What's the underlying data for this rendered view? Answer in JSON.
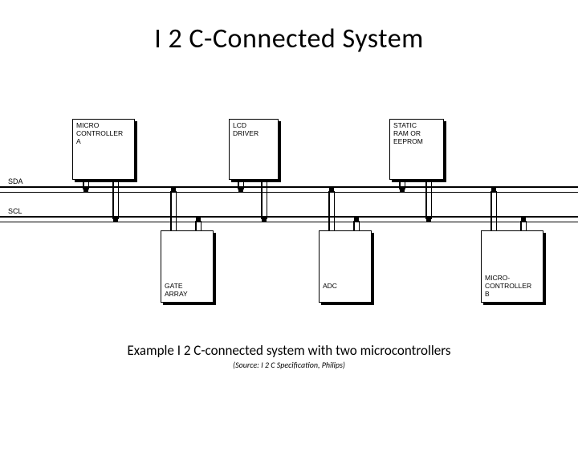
{
  "title": "I 2 C-Connected System",
  "caption": "Example I 2 C-connected system with two microcontrollers",
  "source": "(Source: I 2 C Specification, Philips)",
  "bus": {
    "sda": "SDA",
    "scl": "SCL"
  },
  "devices": {
    "top": [
      {
        "id": "microcontroller-a",
        "label": "MICRO\nCONTROLLER\nA"
      },
      {
        "id": "lcd-driver",
        "label": "LCD\nDRIVER"
      },
      {
        "id": "static-ram-eeprom",
        "label": "STATIC\nRAM OR\nEEPROM"
      }
    ],
    "bottom": [
      {
        "id": "gate-array",
        "label": "GATE\nARRAY"
      },
      {
        "id": "adc",
        "label": "ADC"
      },
      {
        "id": "microcontroller-b",
        "label": "MICRO-\nCONTROLLER\nB"
      }
    ]
  }
}
